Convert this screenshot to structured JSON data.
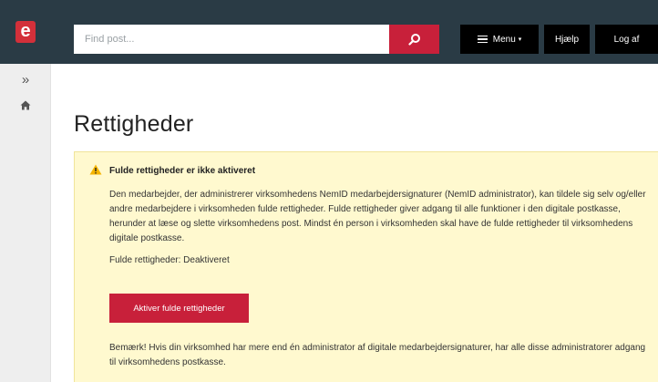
{
  "header": {
    "logo_text": "e",
    "search": {
      "placeholder": "Find post..."
    },
    "menu_label": "Menu",
    "menu_caret": "▾",
    "help_label": "Hjælp",
    "logout_label": "Log af"
  },
  "sidebar": {
    "expand_icon": "»"
  },
  "main": {
    "title": "Rettigheder",
    "alert": {
      "title": "Fulde rettigheder er ikke aktiveret",
      "body": "Den medarbejder, der administrerer virksomhedens NemID medarbejdersignaturer (NemID administrator), kan tildele sig selv og/eller andre medarbejdere i virksomheden fulde rettigheder. Fulde rettigheder giver adgang til alle funktioner i den digitale postkasse, herunder at læse og slette virksomhedens post. Mindst én person i virksomheden skal have de fulde rettigheder til virksomhedens digitale postkasse.",
      "status": "Fulde rettigheder: Deaktiveret",
      "button_label": "Aktiver fulde rettigheder",
      "note": "Bemærk! Hvis din virksomhed har mere end én administrator af digitale medarbejdersignaturer, har alle disse administratorer adgang til virksomhedens postkasse."
    }
  },
  "colors": {
    "header_bg": "#2a3b45",
    "accent_red": "#c8203a",
    "alert_bg": "#fff9cf",
    "warning_yellow": "#f5b400"
  }
}
